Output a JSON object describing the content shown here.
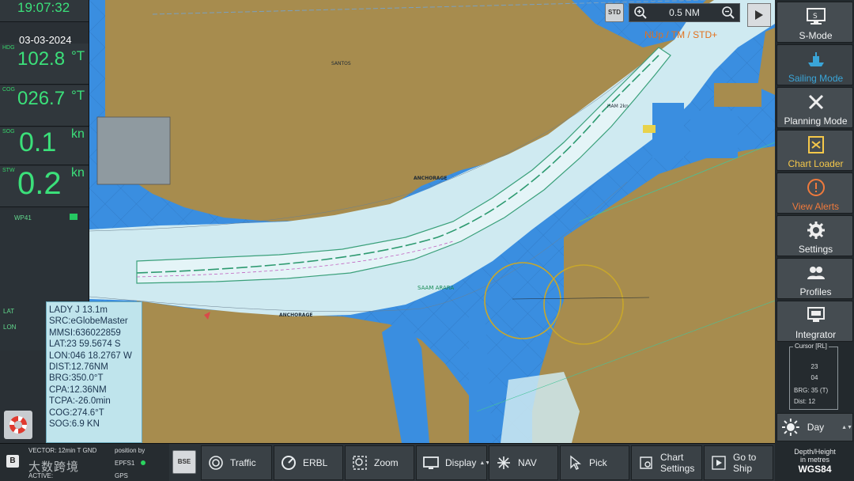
{
  "left_panel": {
    "time": "19:07:32",
    "date": "03-03-2024",
    "hdg": {
      "tag": "HDG",
      "value": "102.8",
      "unit": "°T"
    },
    "cog": {
      "tag": "COG",
      "value": "026.7",
      "unit": "°T"
    },
    "sog": {
      "tag": "SOG",
      "value": "0.1",
      "unit": "kn"
    },
    "stw": {
      "tag": "STW",
      "value": "0.2",
      "unit": "kn"
    },
    "rows": [
      "WP41",
      "LAT",
      "LON"
    ]
  },
  "target": {
    "name": "LADY J 13.1m",
    "src": "SRC:eGlobeMaster",
    "mmsi": "MMSI:636022859",
    "lat": "LAT:23 59.5674 S",
    "lon": "LON:046 18.2767 W",
    "dist": "DIST:12.76NM",
    "brg": "BRG:350.0°T",
    "cpa": "CPA:12.36NM",
    "tcpa": "TCPA:-26.0min",
    "cog": "COG:274.6°T",
    "sog": "SOG:6.9 KN"
  },
  "chart": {
    "orientation": "NUp / TM / STD+",
    "std_label": "STD",
    "zoom_value": "0.5 NM",
    "labels": {
      "santos": "SANTOS",
      "anchorage1": "ANCHORAGE",
      "anchorage2": "ANCHORAGE",
      "ham": "HAM 2kn",
      "saam": "SAAM ARARA"
    }
  },
  "modes": [
    {
      "label": "S-Mode",
      "icon": "monitor-icon"
    },
    {
      "label": "Sailing Mode",
      "icon": "ship-icon"
    },
    {
      "label": "Planning Mode",
      "icon": "tools-icon"
    },
    {
      "label": "Chart Loader",
      "icon": "chart-loader-icon"
    },
    {
      "label": "View Alerts",
      "icon": "alert-icon"
    },
    {
      "label": "Settings",
      "icon": "gear-icon"
    },
    {
      "label": "Profiles",
      "icon": "profiles-icon"
    },
    {
      "label": "Integrator",
      "icon": "integrator-icon"
    }
  ],
  "cursor": {
    "title": "Cursor [RL]",
    "line1": "23",
    "line2": "04",
    "brg": "BRG: 35 (T)",
    "dist": "Dist: 12"
  },
  "palette": {
    "label": "Day"
  },
  "datum": {
    "line1": "Depth/Height",
    "line2": "in metres",
    "line3": "WGS84"
  },
  "status": {
    "vector": "VECTOR: 12min T GND",
    "position_by": "position by",
    "epfs": "EPFS1",
    "gps": "GPS",
    "active": "ACTIVE:",
    "watermark": "大数跨境"
  },
  "toolbar": {
    "bse": "BSE",
    "traffic": "Traffic",
    "erbl": "ERBL",
    "zoom": "Zoom",
    "display": "Display",
    "nav": "NAV",
    "pick": "Pick",
    "chart_settings": [
      "Chart",
      "Settings"
    ],
    "go_to_ship": [
      "Go to",
      "Ship"
    ]
  },
  "colors": {
    "accent_green": "#3be07a",
    "land": "#a78c4e",
    "deep_water": "#3a8ee0",
    "shallow_water": "#cfeaf1",
    "channel": "#d8eef3",
    "orientation": "#e2711d"
  }
}
